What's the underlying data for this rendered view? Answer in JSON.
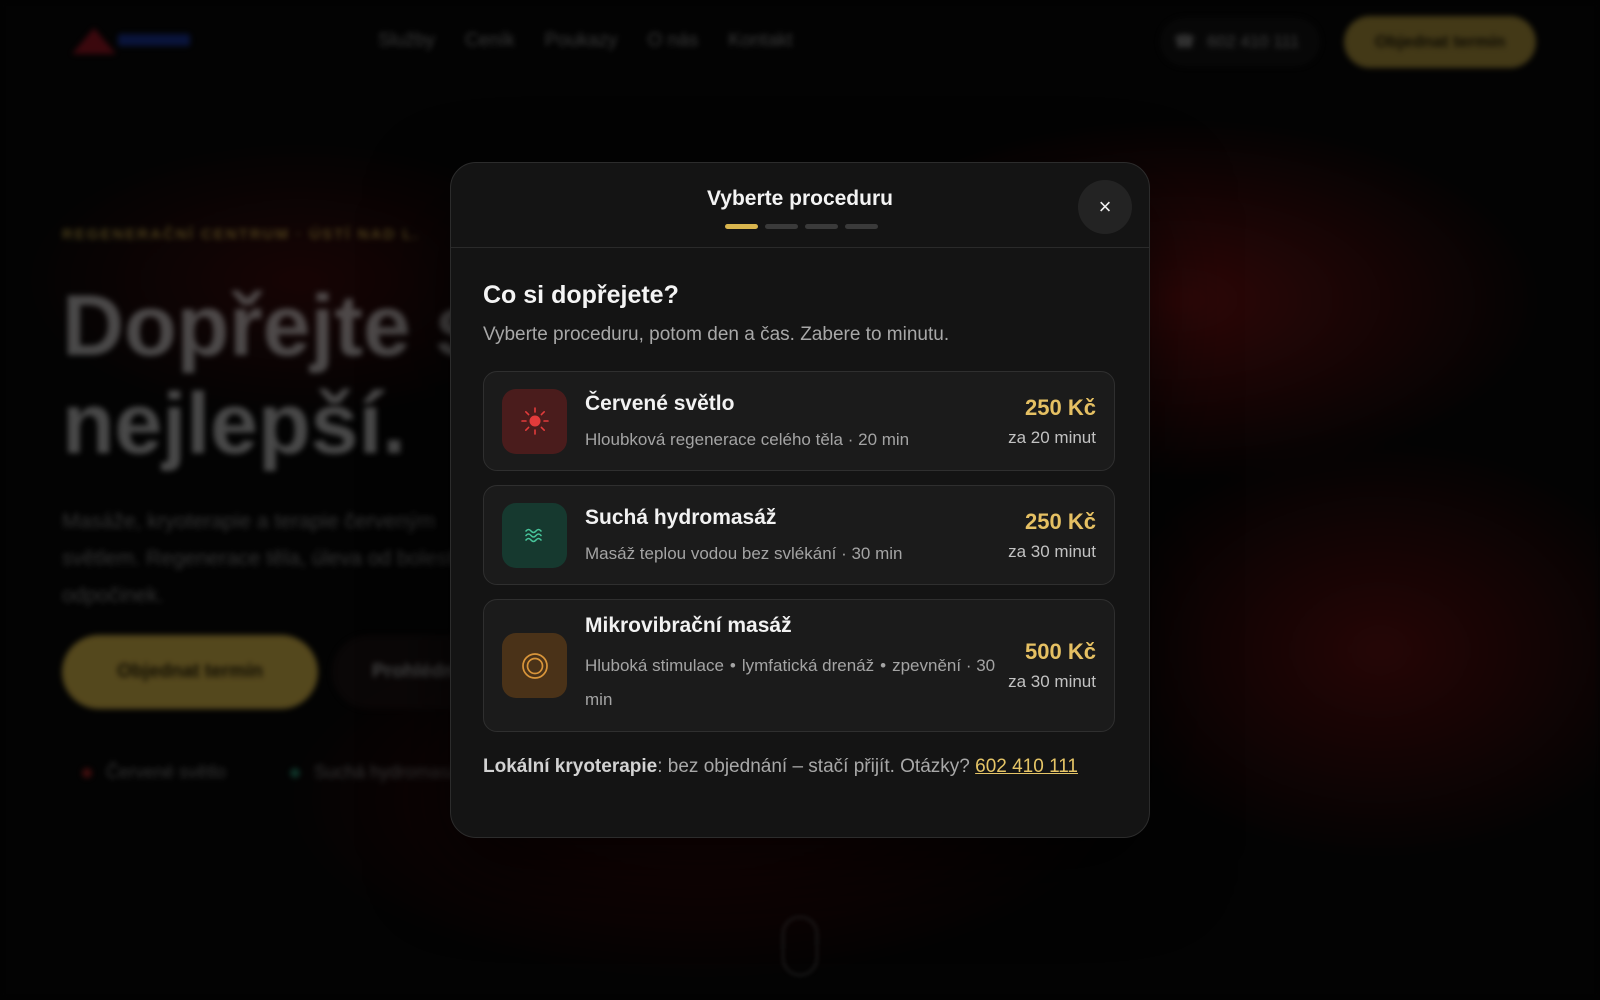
{
  "background": {
    "nav_items": [
      "Služby",
      "Ceník",
      "Poukazy",
      "O nás",
      "Kontakt"
    ],
    "phone": "602 410 111",
    "cta": "Objednat termín",
    "hero": {
      "eyebrow": "REGENERAČNÍ CENTRUM · ÚSTÍ NAD L.",
      "title_line1": "Dopřejte s",
      "title_line2": "nejlepší.",
      "subtitle": "Masáže, kryoterapie a terapie červeným světlem. Regenerace těla, úleva od bolesti a odpočinek.",
      "primary_button": "Objednat termín",
      "secondary_button": "Prohlédnout",
      "features": [
        "Červené světlo",
        "Suchá hydromasáž"
      ]
    }
  },
  "modal": {
    "title": "Vyberte proceduru",
    "steps": {
      "total": 4,
      "current": 1
    },
    "close_icon": "×",
    "heading": "Co si dopřejete?",
    "subtitle": "Vyberte proceduru, potom den a čas. Zabere to minutu.",
    "procedures": [
      {
        "name": "Červené světlo",
        "description": "Hloubková regenerace celého těla · 20 min",
        "price": "250 Kč",
        "per": "za 20 minut",
        "icon": "sun-icon",
        "accent": "#e23b3b"
      },
      {
        "name": "Suchá hydromasáž",
        "description": "Masáž teplou vodou bez svlékání · 30 min",
        "price": "250 Kč",
        "per": "za 30 minut",
        "icon": "waves-icon",
        "accent": "#47c49a"
      },
      {
        "name": "Mikrovibrační masáž",
        "tags": [
          "Hluboká stimulace",
          "lymfatická drenáž",
          "zpevnění"
        ],
        "duration": "30 min",
        "price": "500 Kč",
        "per": "za 30 minut",
        "icon": "target-rings-icon",
        "accent": "#d9953a"
      }
    ],
    "footer": {
      "bold": "Lokální kryoterapie",
      "text": ": bez objednání – stačí přijít. Otázky? ",
      "phone_link": "602 410 111"
    }
  }
}
